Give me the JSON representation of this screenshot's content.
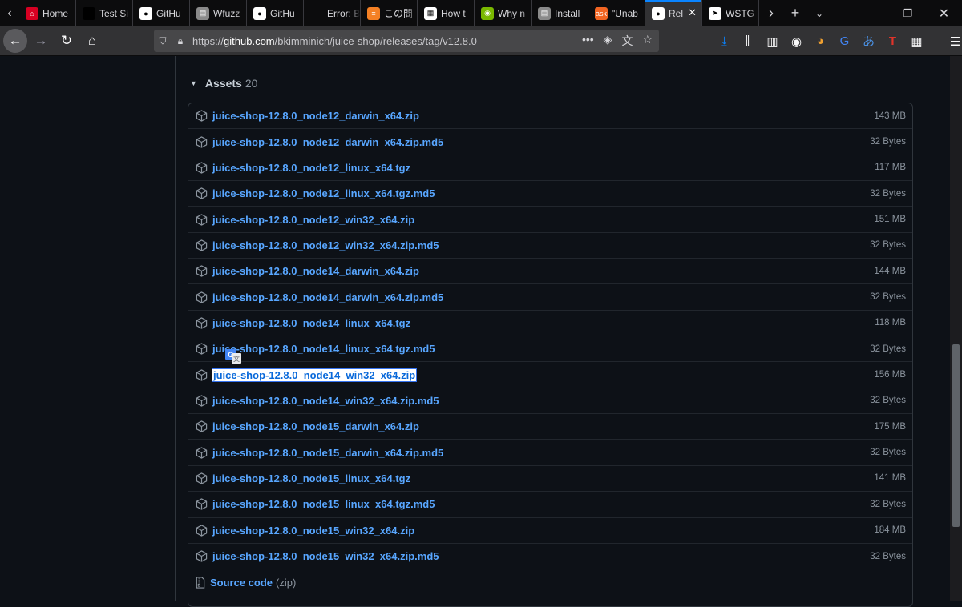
{
  "browser": {
    "tabs": [
      {
        "label": "Home",
        "fav_color": "#d70022",
        "fav_glyph": "⌂"
      },
      {
        "label": "Test Si",
        "fav_color": "#000000",
        "fav_glyph": ""
      },
      {
        "label": "GitHu",
        "fav_color": "#ffffff",
        "fav_glyph": "●"
      },
      {
        "label": "Wfuzz",
        "fav_color": "#8a8a8a",
        "fav_glyph": "▤"
      },
      {
        "label": "GitHu",
        "fav_color": "#ffffff",
        "fav_glyph": "●"
      },
      {
        "label": "Error: Bloc",
        "fav_color": "",
        "fav_glyph": ""
      },
      {
        "label": "この問",
        "fav_color": "#f48024",
        "fav_glyph": "≡"
      },
      {
        "label": "How t",
        "fav_color": "#ffffff",
        "fav_glyph": "▦"
      },
      {
        "label": "Why n",
        "fav_color": "#7ab800",
        "fav_glyph": "◉"
      },
      {
        "label": "Install",
        "fav_color": "#8a8a8a",
        "fav_glyph": "▤"
      },
      {
        "label": "\"Unab",
        "fav_color": "#f26522",
        "fav_glyph": "ask"
      },
      {
        "label": "Rel",
        "fav_color": "#ffffff",
        "fav_glyph": "●",
        "active": true
      },
      {
        "label": "WSTG",
        "fav_color": "#ffffff",
        "fav_glyph": "➤"
      }
    ],
    "url_prefix": "https://",
    "url_domain": "github.com",
    "url_path": "/bkimminich/juice-shop/releases/tag/v12.8.0"
  },
  "assets": {
    "title": "Assets",
    "count": "20",
    "items": [
      {
        "name": "juice-shop-12.8.0_node12_darwin_x64.zip",
        "size": "143 MB"
      },
      {
        "name": "juice-shop-12.8.0_node12_darwin_x64.zip.md5",
        "size": "32 Bytes"
      },
      {
        "name": "juice-shop-12.8.0_node12_linux_x64.tgz",
        "size": "117 MB"
      },
      {
        "name": "juice-shop-12.8.0_node12_linux_x64.tgz.md5",
        "size": "32 Bytes"
      },
      {
        "name": "juice-shop-12.8.0_node12_win32_x64.zip",
        "size": "151 MB"
      },
      {
        "name": "juice-shop-12.8.0_node12_win32_x64.zip.md5",
        "size": "32 Bytes"
      },
      {
        "name": "juice-shop-12.8.0_node14_darwin_x64.zip",
        "size": "144 MB"
      },
      {
        "name": "juice-shop-12.8.0_node14_darwin_x64.zip.md5",
        "size": "32 Bytes"
      },
      {
        "name": "juice-shop-12.8.0_node14_linux_x64.tgz",
        "size": "118 MB"
      },
      {
        "name": "juice-shop-12.8.0_node14_linux_x64.tgz.md5",
        "size": "32 Bytes"
      },
      {
        "name": "juice-shop-12.8.0_node14_win32_x64.zip",
        "size": "156 MB",
        "selected": true
      },
      {
        "name": "juice-shop-12.8.0_node14_win32_x64.zip.md5",
        "size": "32 Bytes"
      },
      {
        "name": "juice-shop-12.8.0_node15_darwin_x64.zip",
        "size": "175 MB"
      },
      {
        "name": "juice-shop-12.8.0_node15_darwin_x64.zip.md5",
        "size": "32 Bytes"
      },
      {
        "name": "juice-shop-12.8.0_node15_linux_x64.tgz",
        "size": "141 MB"
      },
      {
        "name": "juice-shop-12.8.0_node15_linux_x64.tgz.md5",
        "size": "32 Bytes"
      },
      {
        "name": "juice-shop-12.8.0_node15_win32_x64.zip",
        "size": "184 MB"
      },
      {
        "name": "juice-shop-12.8.0_node15_win32_x64.zip.md5",
        "size": "32 Bytes"
      }
    ],
    "source_code": {
      "label": "Source code",
      "ext": "(zip)"
    }
  },
  "colors": {
    "link": "#58a6ff",
    "muted": "#8b949e",
    "background": "#0d1117"
  }
}
